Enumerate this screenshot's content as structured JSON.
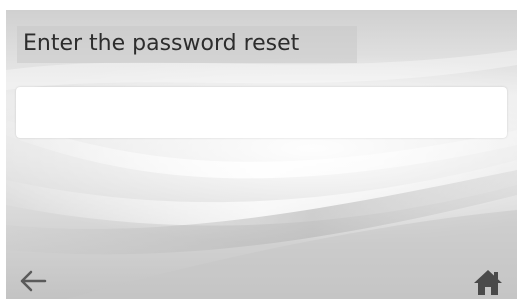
{
  "screen": {
    "title": "Enter the password reset",
    "input": {
      "value": "",
      "placeholder": ""
    }
  },
  "nav": {
    "back_icon": "arrow-left-icon",
    "home_icon": "home-icon"
  },
  "colors": {
    "title_text": "#2d2d2d",
    "icon": "#5a5a5a",
    "input_bg": "#ffffff"
  }
}
